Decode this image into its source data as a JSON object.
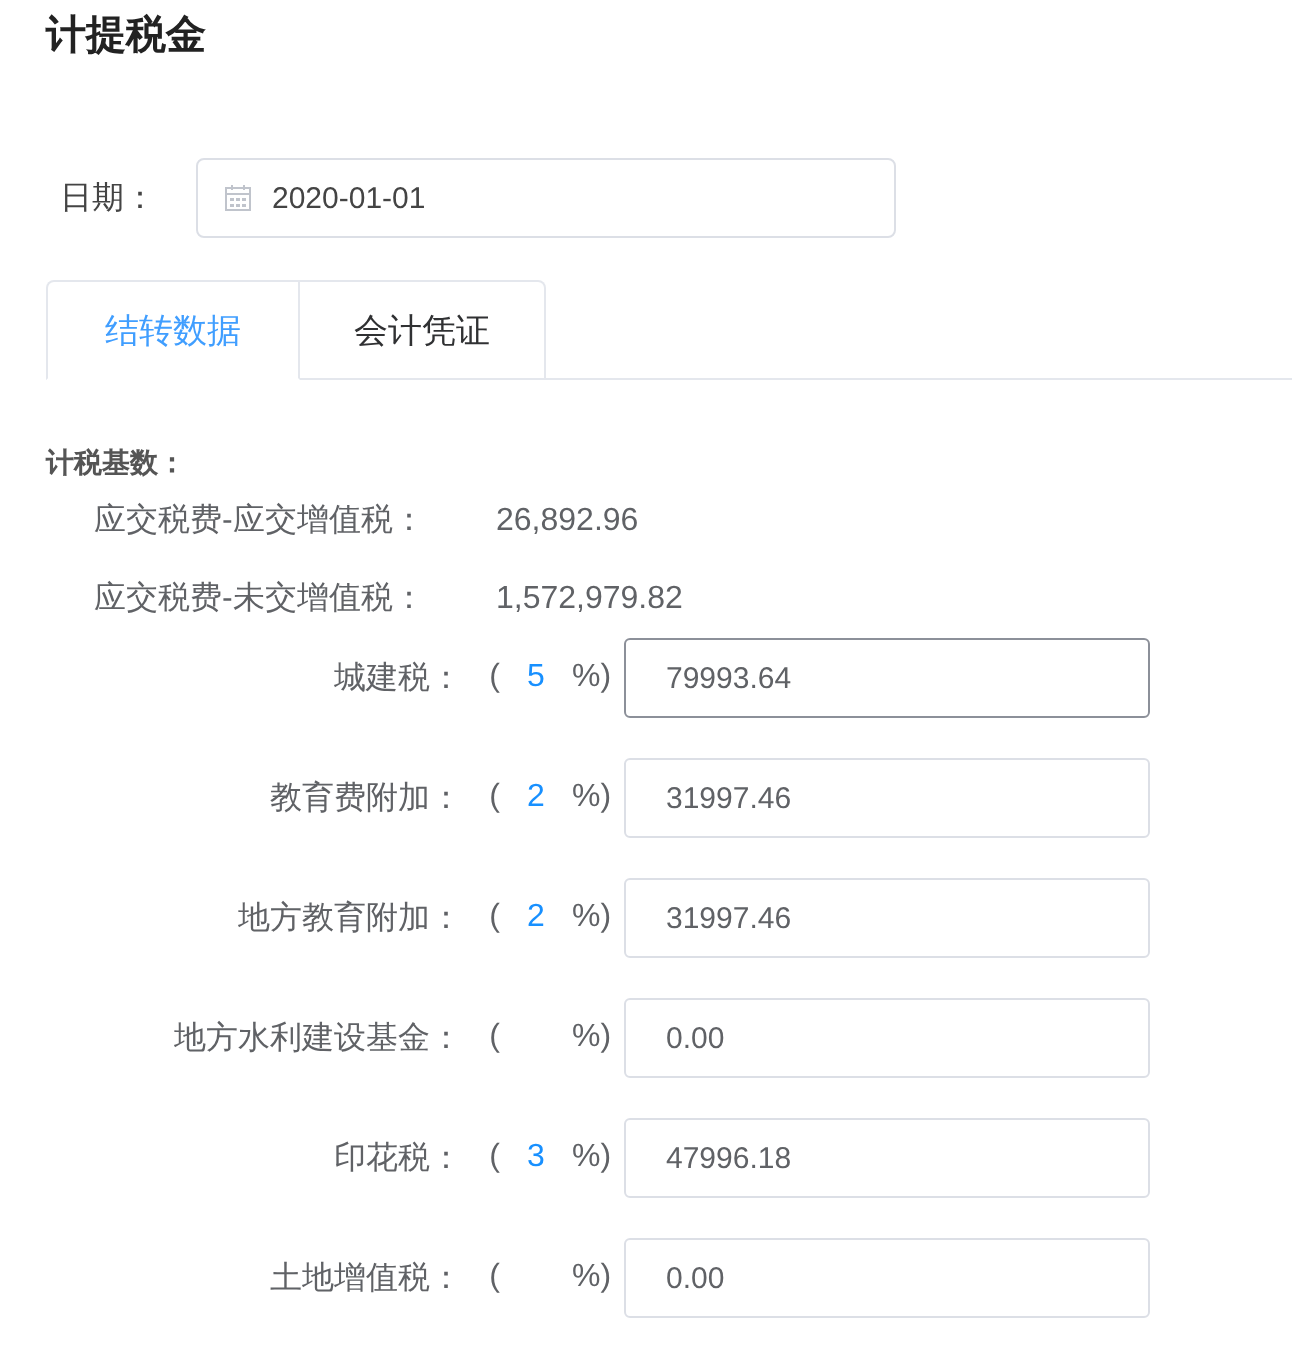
{
  "title": "计提税金",
  "date": {
    "label": "日期：",
    "value": "2020-01-01"
  },
  "tabs": [
    {
      "label": "结转数据",
      "selected": true
    },
    {
      "label": "会计凭证",
      "selected": false
    }
  ],
  "section_label": "计税基数：",
  "bases": [
    {
      "label": "应交税费-应交增值税：",
      "value": "26,892.96"
    },
    {
      "label": "应交税费-未交增值税：",
      "value": "1,572,979.82"
    }
  ],
  "taxes": [
    {
      "label": "城建税：",
      "open": "(",
      "rate": "5",
      "close": "%)",
      "value": "79993.64",
      "focused": true
    },
    {
      "label": "教育费附加：",
      "open": "(",
      "rate": "2",
      "close": "%)",
      "value": "31997.46",
      "focused": false
    },
    {
      "label": "地方教育附加：",
      "open": "(",
      "rate": "2",
      "close": "%)",
      "value": "31997.46",
      "focused": false
    },
    {
      "label": "地方水利建设基金：",
      "open": "(",
      "close": "%)",
      "value": "0.00",
      "focused": false
    },
    {
      "label": "印花税：",
      "open": "(",
      "rate": "3",
      "close": "%)",
      "value": "47996.18",
      "focused": false
    },
    {
      "label": "土地增值税：",
      "open": "(",
      "close": "%)",
      "value": "0.00",
      "focused": false
    }
  ]
}
